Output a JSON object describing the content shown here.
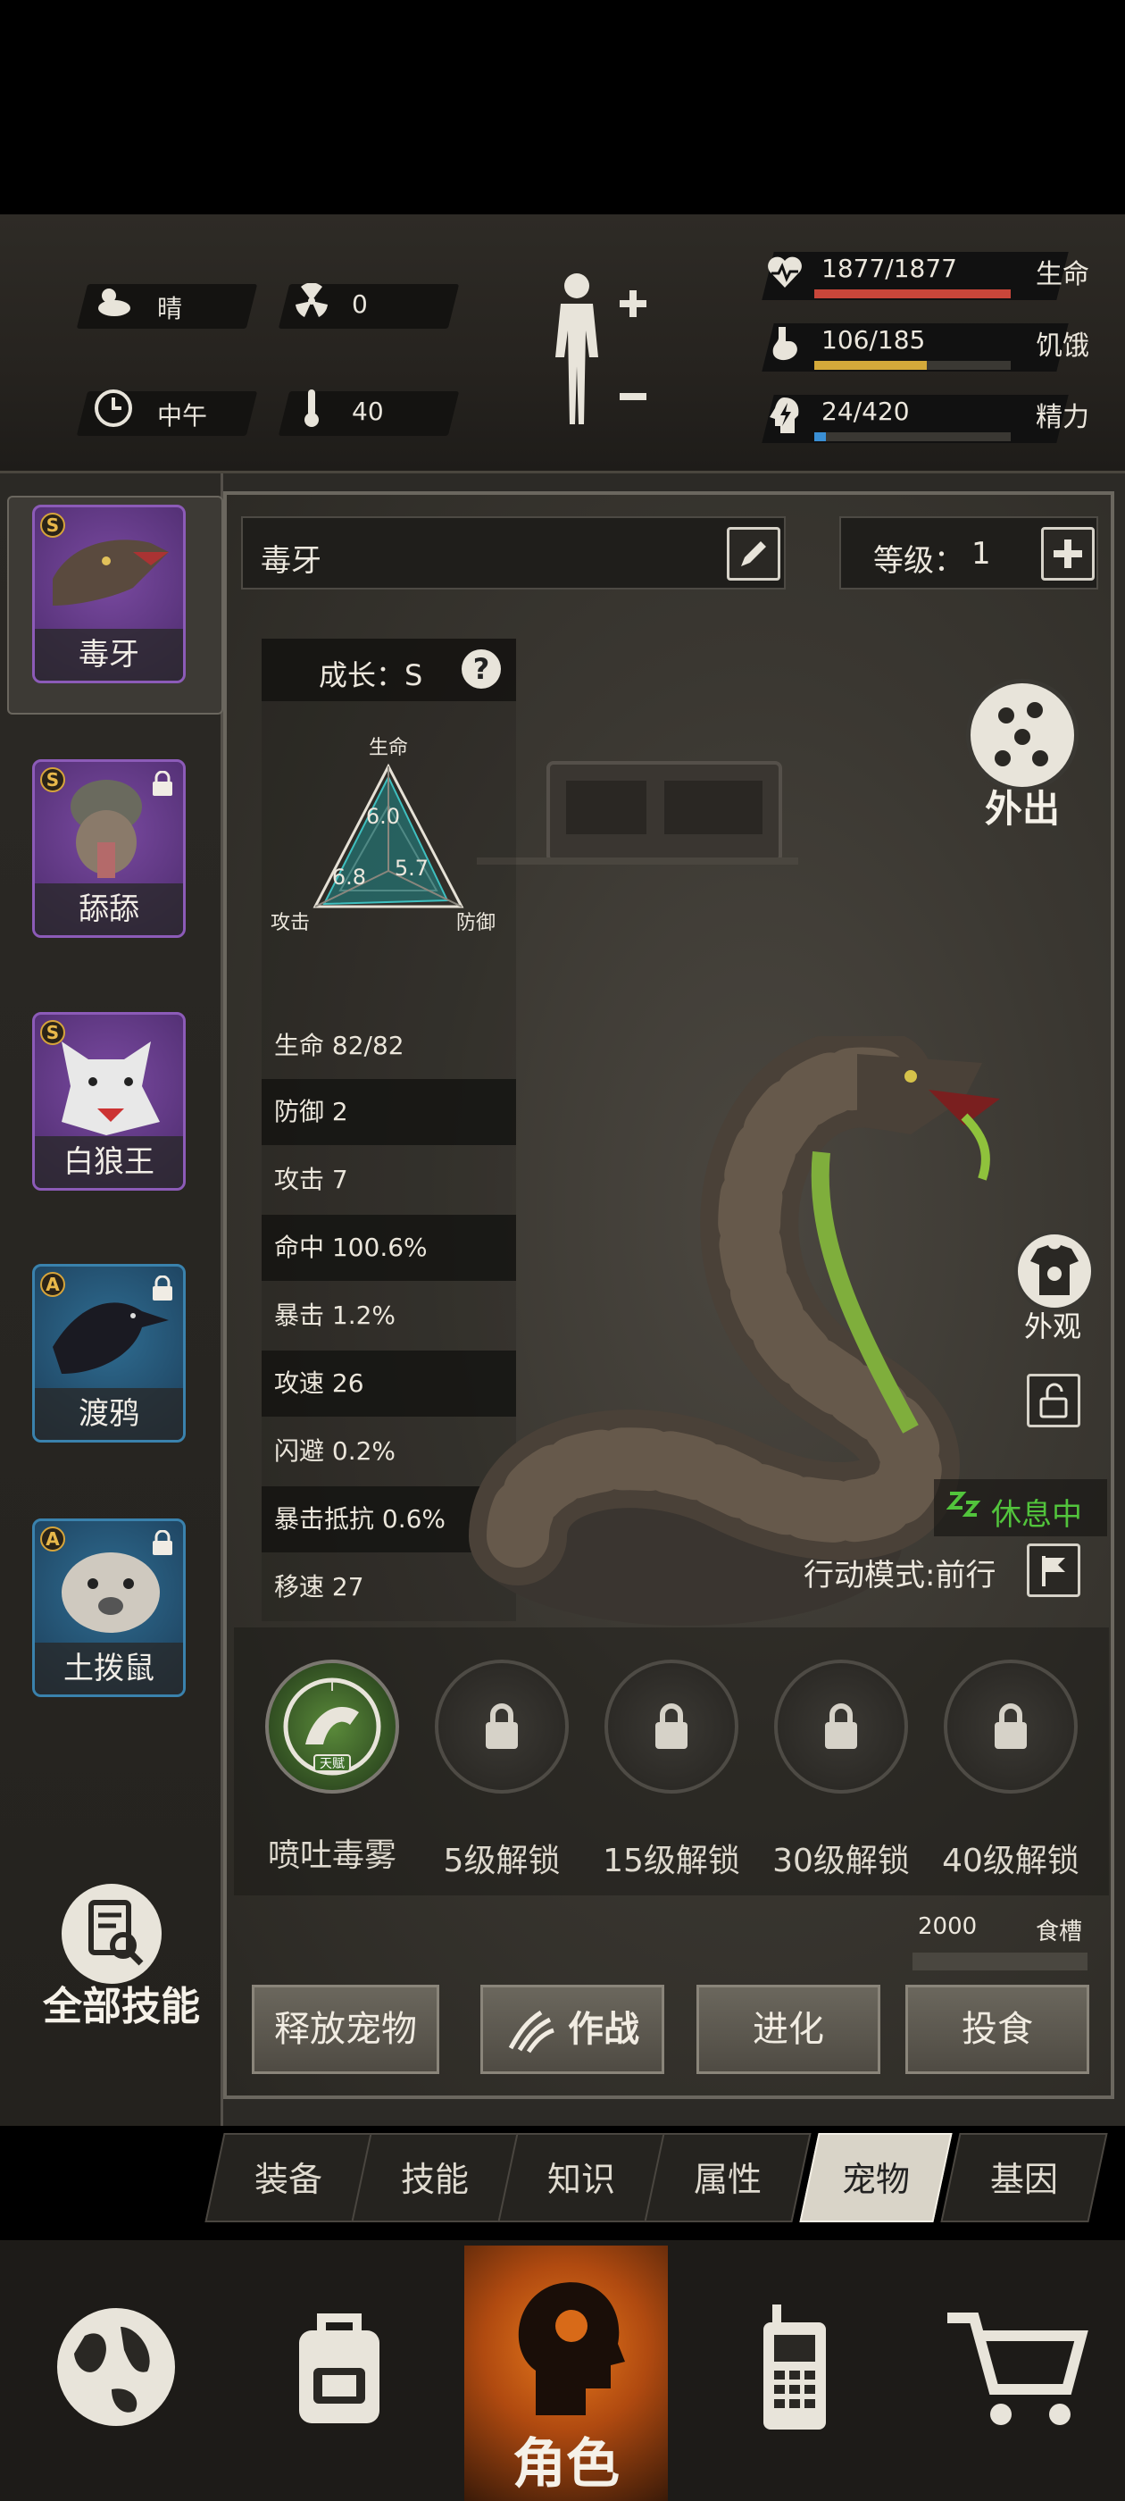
{
  "status": {
    "weather": "晴",
    "radiation": "0",
    "time_of_day": "中午",
    "temperature": "40",
    "vitals": [
      {
        "name": "生命",
        "value": "1877/1877",
        "fill": 1.0,
        "color": "#c8463a",
        "icon": "heart-pulse-icon"
      },
      {
        "name": "饥饿",
        "value": "106/185",
        "fill": 0.573,
        "color": "#d4a93a",
        "icon": "stomach-icon"
      },
      {
        "name": "精力",
        "value": "24/420",
        "fill": 0.057,
        "color": "#3a8fd4",
        "icon": "head-bolt-icon"
      }
    ]
  },
  "pets": [
    {
      "name": "毒牙",
      "rank": "S",
      "locked": false,
      "tier": "purple",
      "selected": true
    },
    {
      "name": "舔舔",
      "rank": "S",
      "locked": true,
      "tier": "purple",
      "selected": false
    },
    {
      "name": "白狼王",
      "rank": "S",
      "locked": false,
      "tier": "purple",
      "selected": false
    },
    {
      "name": "渡鸦",
      "rank": "A",
      "locked": true,
      "tier": "blue",
      "selected": false
    },
    {
      "name": "土拨鼠",
      "rank": "A",
      "locked": true,
      "tier": "blue",
      "selected": false
    }
  ],
  "all_skills_label": "全部技能",
  "pet": {
    "name": "毒牙",
    "level_label": "等级：",
    "level": "1",
    "growth_label": "成长：S",
    "radar": {
      "labels": [
        "生命",
        "攻击",
        "防御"
      ],
      "values": [
        "6.0",
        "6.8",
        "5.7"
      ]
    },
    "stats": [
      "生命 82/82",
      "防御 2",
      "攻击 7",
      "命中 100.6%",
      "暴击 1.2%",
      "攻速 26",
      "闪避 0.2%",
      "暴击抵抗 0.6%",
      "移速 27"
    ],
    "outing_label": "外出",
    "appearance_label": "外观",
    "state_label": "休息中",
    "action_mode": "行动模式:前行",
    "food_value": "2000",
    "food_label": "食槽"
  },
  "skills": [
    {
      "label": "喷吐毒雾",
      "locked": false,
      "tag": "天赋",
      "roman": "I"
    },
    {
      "label": "5级解锁",
      "locked": true
    },
    {
      "label": "15级解锁",
      "locked": true
    },
    {
      "label": "30级解锁",
      "locked": true
    },
    {
      "label": "40级解锁",
      "locked": true
    }
  ],
  "actions": [
    "释放宠物",
    "作战",
    "进化",
    "投食"
  ],
  "tabs": [
    "装备",
    "技能",
    "知识",
    "属性",
    "宠物",
    "基因"
  ],
  "active_tab": "宠物",
  "nav": {
    "character_label": "角色"
  }
}
